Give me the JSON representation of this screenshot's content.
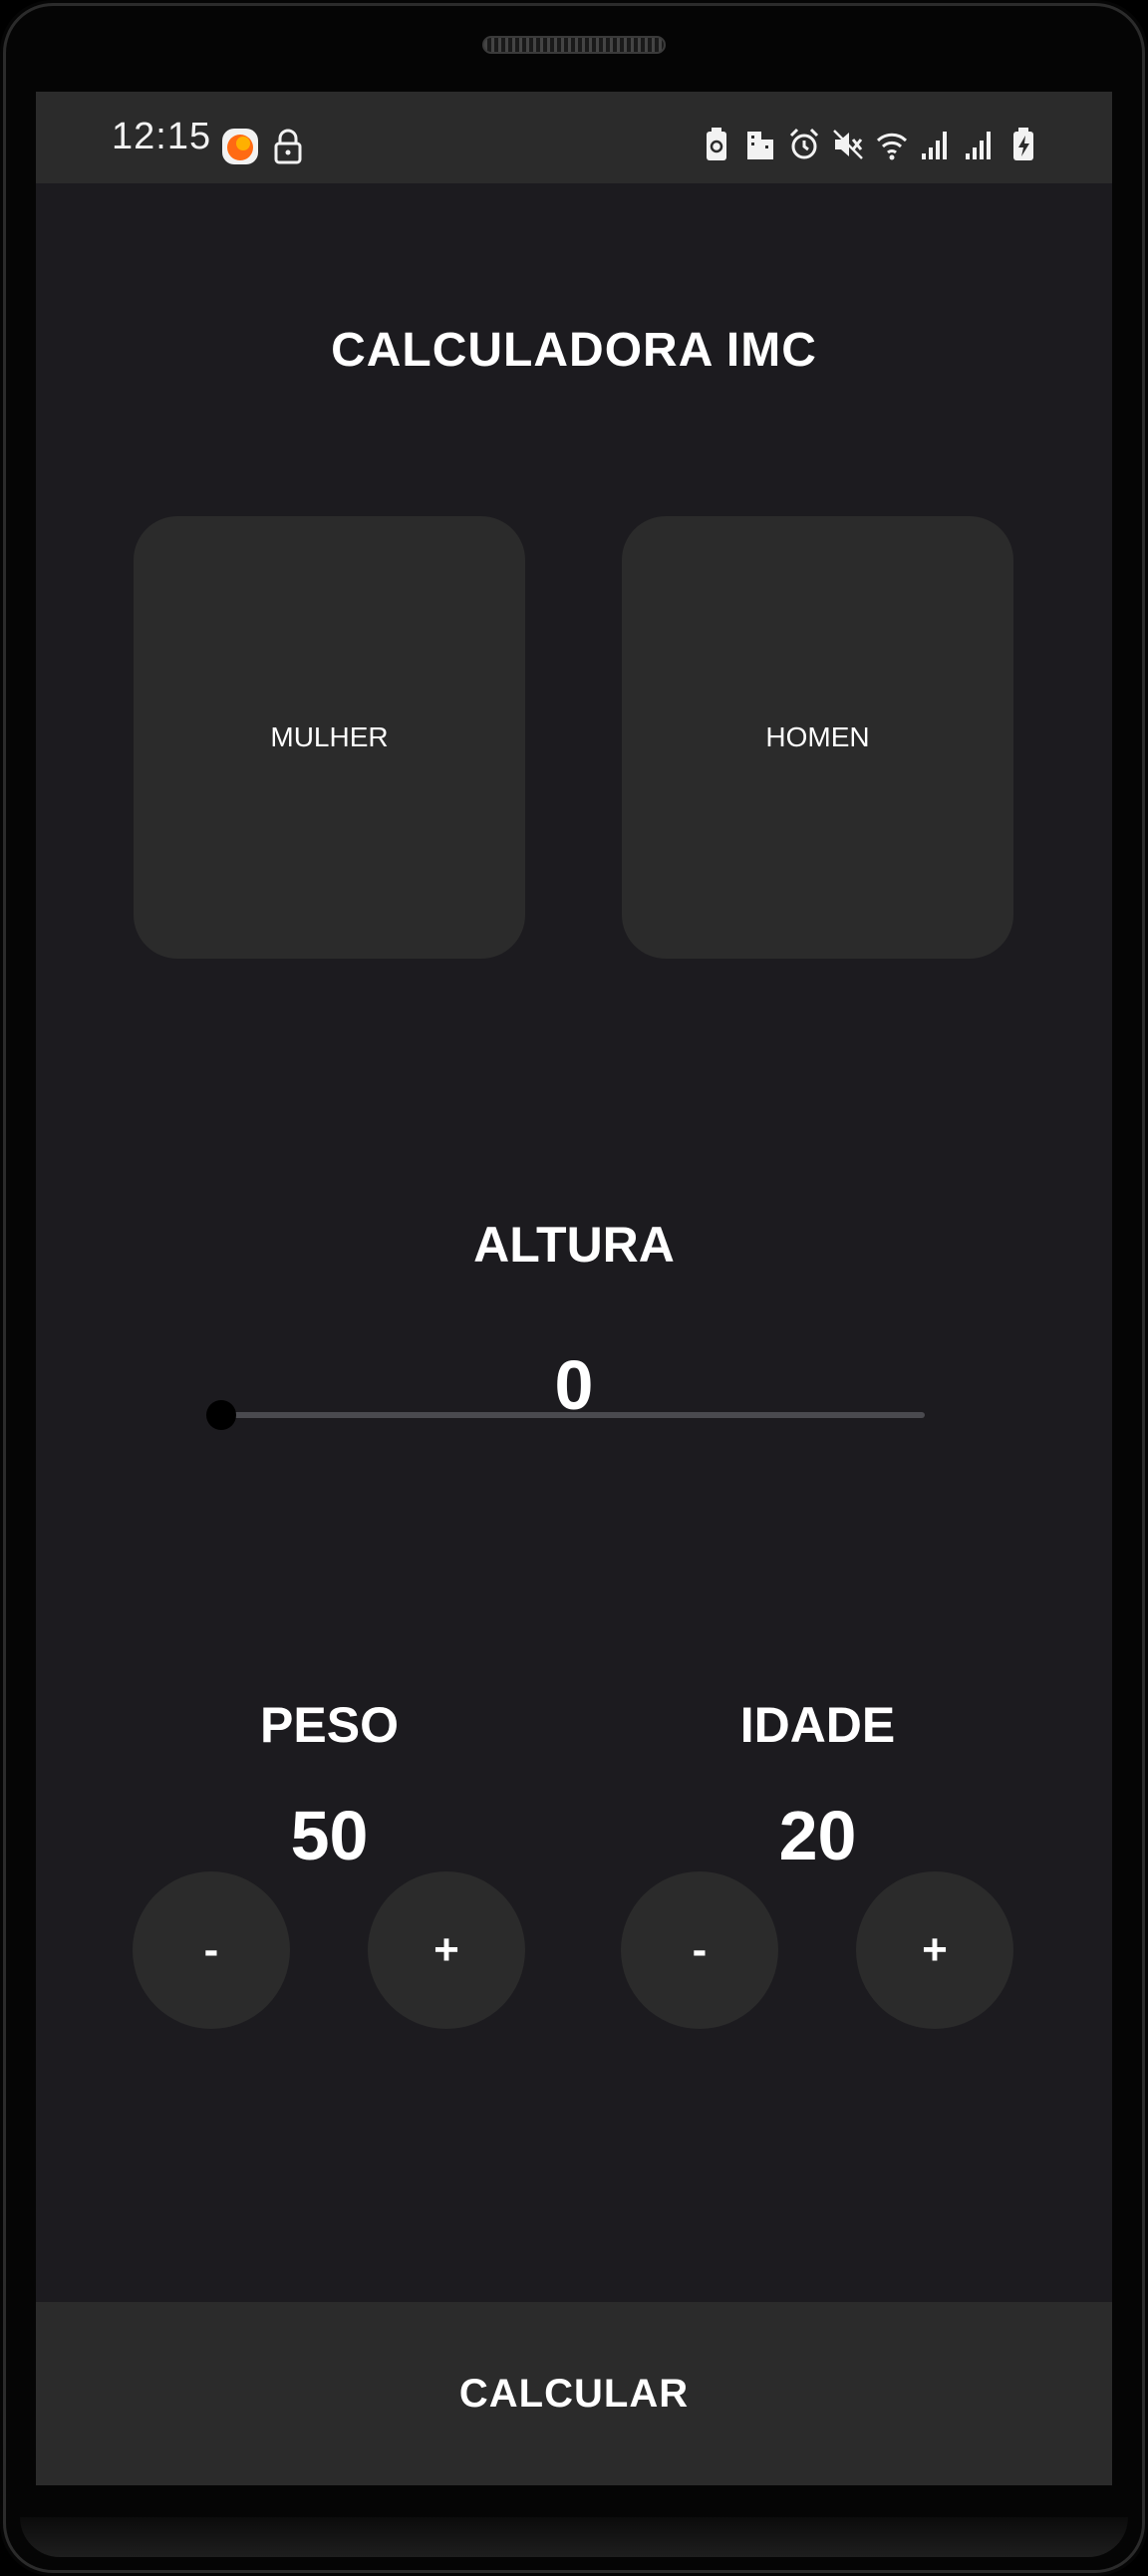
{
  "status_bar": {
    "time": "12:15",
    "icons": [
      "app-notification-icon",
      "lock-icon",
      "battery-saver-icon",
      "building-icon",
      "alarm-icon",
      "mute-icon",
      "wifi-icon",
      "signal-1-icon",
      "signal-2-icon",
      "battery-charging-icon"
    ]
  },
  "app": {
    "title": "CALCULADORA IMC",
    "gender": {
      "female_label": "MULHER",
      "male_label": "HOMEN"
    },
    "height": {
      "label": "ALTURA",
      "value": "0",
      "slider_fraction": 0
    },
    "weight": {
      "label": "PESO",
      "value": "50",
      "minus": "-",
      "plus": "+"
    },
    "age": {
      "label": "IDADE",
      "value": "20",
      "minus": "-",
      "plus": "+"
    },
    "calculate_label": "CALCULAR"
  },
  "colors": {
    "background": "#1c1b1f",
    "surface": "#2b2b2b",
    "text": "#ffffff",
    "slider_track": "#4a4a4f",
    "slider_thumb": "#000000"
  }
}
